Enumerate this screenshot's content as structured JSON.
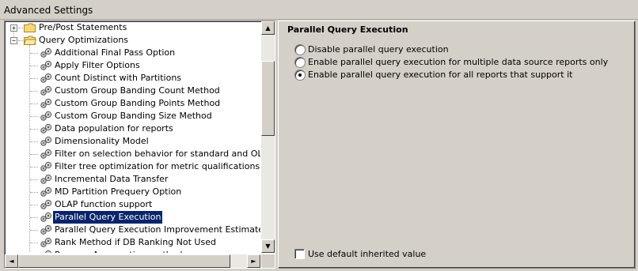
{
  "window": {
    "title": "Advanced Settings"
  },
  "tree": {
    "top_items": [
      {
        "label": "Pre/Post Statements",
        "expander": "+",
        "icon": "folder-icon"
      },
      {
        "label": "Query Optimizations",
        "expander": "−",
        "icon": "open-folder-icon"
      }
    ],
    "children": [
      {
        "label": "Additional Final Pass Option"
      },
      {
        "label": "Apply Filter Options"
      },
      {
        "label": "Count Distinct with Partitions"
      },
      {
        "label": "Custom Group Banding Count Method"
      },
      {
        "label": "Custom Group Banding Points Method"
      },
      {
        "label": "Custom Group Banding Size Method"
      },
      {
        "label": "Data population for reports"
      },
      {
        "label": "Dimensionality Model"
      },
      {
        "label": "Filter on selection behavior for standard and OLAP Rep"
      },
      {
        "label": "Filter tree optimization for metric qualifications"
      },
      {
        "label": "Incremental Data Transfer"
      },
      {
        "label": "MD Partition Prequery Option"
      },
      {
        "label": "OLAP function support"
      },
      {
        "label": "Parallel Query Execution",
        "selected": true
      },
      {
        "label": "Parallel Query Execution Improvement Estimate in SQL"
      },
      {
        "label": "Rank Method if DB Ranking Not Used"
      },
      {
        "label": "Remove Aggregation method"
      }
    ],
    "scroll": {
      "up": "▲",
      "down": "▼",
      "left": "◄",
      "right": "►"
    }
  },
  "settings": {
    "title": "Parallel Query Execution",
    "options": [
      {
        "label": "Disable parallel query execution",
        "checked": false
      },
      {
        "label": "Enable parallel query execution for multiple data source reports only",
        "checked": false
      },
      {
        "label": "Enable parallel query execution for all reports that support it",
        "checked": true
      }
    ],
    "default_checkbox": {
      "label": "Use default inherited value",
      "checked": false
    }
  },
  "colors": {
    "selection": "#0a246a",
    "face": "#d4d0c8"
  }
}
